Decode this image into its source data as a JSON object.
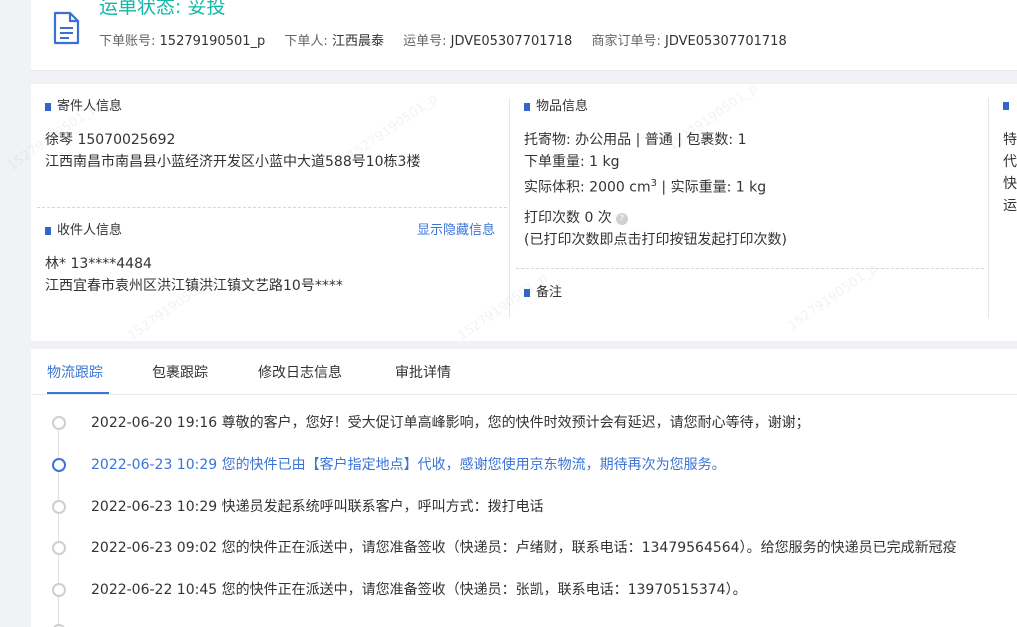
{
  "header": {
    "status": "运单状态: 妥投",
    "meta": [
      {
        "label": "下单账号:",
        "value": "15279190501_p"
      },
      {
        "label": "下单人:",
        "value": "江西晨泰"
      },
      {
        "label": "运单号:",
        "value": "JDVE05307701718"
      },
      {
        "label": "商家订单号:",
        "value": "JDVE05307701718"
      }
    ]
  },
  "sender": {
    "title": "寄件人信息",
    "name_phone": "徐琴   15070025692",
    "address": "江西南昌市南昌县小蓝经济开发区小蓝中大道588号10栋3楼"
  },
  "receiver": {
    "title": "收件人信息",
    "show_hidden": "显示隐藏信息",
    "name_phone": "林*   13****4484",
    "address": "江西宜春市袁州区洪江镇洪江镇文艺路10号****"
  },
  "goods": {
    "title": "物品信息",
    "line1": "托寄物:  办公用品 | 普通  |  包裹数:  1",
    "line2": "下单重量:  1 kg",
    "line3a": "实际体积:   2000 cm",
    "line3sup": "3",
    "line3b": " |  实际重量:   1 kg",
    "print": "打印次数    0 次",
    "print_note": "(已打印次数即点击打印按钮发起打印次数)"
  },
  "remark": {
    "title": "备注"
  },
  "right_col": {
    "chars": [
      "特",
      "代",
      "快",
      "运"
    ]
  },
  "tabs": [
    "物流跟踪",
    "包裹跟踪",
    "修改日志信息",
    "审批详情"
  ],
  "events": [
    {
      "text": "2022-06-20 19:16  尊敬的客户，您好！受大促订单高峰影响，您的快件时效预计会有延迟，请您耐心等待，谢谢；",
      "active": false
    },
    {
      "text": "2022-06-23 10:29  您的快件已由【客户指定地点】代收，感谢您使用京东物流，期待再次为您服务。",
      "active": true
    },
    {
      "text": "2022-06-23 10:29  快递员发起系统呼叫联系客户，呼叫方式：拨打电话",
      "active": false
    },
    {
      "text": "2022-06-23 09:02  您的快件正在派送中，请您准备签收（快递员：卢绪财，联系电话：13479564564）。给您服务的快递员已完成新冠疫",
      "active": false
    },
    {
      "text": "2022-06-22 10:45  您的快件正在派送中，请您准备签收（快递员：张凯，联系电话：13970515374）。",
      "active": false
    }
  ],
  "colors": {
    "accent": "#3b74d6",
    "status": "#14b8a6"
  }
}
